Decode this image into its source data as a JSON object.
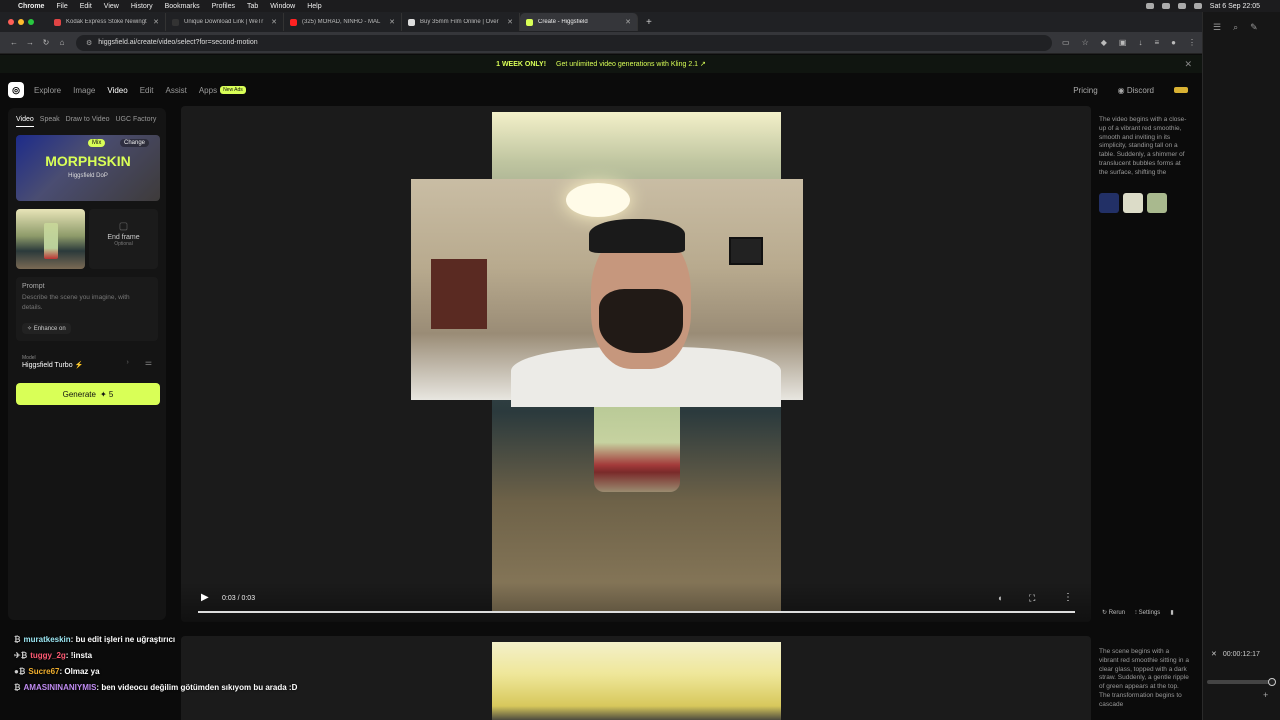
{
  "menubar": {
    "app": "Chrome",
    "items": [
      "File",
      "Edit",
      "View",
      "History",
      "Bookmarks",
      "Profiles",
      "Tab",
      "Window",
      "Help"
    ],
    "clock": "Sat 6 Sep  22:05"
  },
  "tabs": [
    {
      "title": "Kodak Express Stoke Newingt",
      "favcolor": "#e04444"
    },
    {
      "title": "Unique Download Link | WeTr",
      "favcolor": "#333333"
    },
    {
      "title": "(325) MORAD, NINHO - MAL",
      "favcolor": "#ff2222"
    },
    {
      "title": "Buy 35mm Film Online | Over",
      "favcolor": "#dddddd"
    },
    {
      "title": "Create - Higgsfield",
      "favcolor": "#d9ff57"
    }
  ],
  "address": {
    "url": "higgsfield.ai/create/video/select?for=second-motion"
  },
  "banner": {
    "tag": "1 WEEK ONLY!",
    "text": "Get unlimited video generations with Kling 2.1 ↗"
  },
  "nav": {
    "links": [
      "Explore",
      "Image",
      "Video",
      "Edit",
      "Assist",
      "Apps"
    ],
    "apps_badge": "New Ads",
    "pricing": "Pricing",
    "discord": "Discord"
  },
  "left": {
    "subtabs": [
      "Video",
      "Speak",
      "Draw to Video",
      "UGC Factory"
    ],
    "effect": {
      "name": "MORPHSKIN",
      "sub": "Higgsfield DoP",
      "mix": "Mix",
      "change": "Change"
    },
    "end_frame": {
      "title": "End frame",
      "sub": "Optional"
    },
    "prompt": {
      "label": "Prompt",
      "placeholder": "Describe the scene you imagine, with details.",
      "enhance": "Enhance on"
    },
    "model": {
      "label": "Model",
      "value": "Higgsfield Turbo ⚡"
    },
    "generate": {
      "label": "Generate",
      "credits": "✦ 5"
    }
  },
  "player": {
    "time": "0:03 / 0:03"
  },
  "description1": "The video begins with a close-up of a vibrant red smoothie, smooth and inviting in its simplicity, standing tall on a table. Suddenly, a shimmer of translucent bubbles forms at the surface, shifting the",
  "actions": {
    "rerun": "Rerun",
    "settings": "Settings"
  },
  "description2": "The scene begins with a vibrant red smoothie sitting in a clear glass, topped with a dark straw. Suddenly, a gentle ripple of green appears at the top. The transformation begins to cascade",
  "chat": [
    {
      "user": "muratkeskin",
      "msg": "bu edit işleri ne uğraştırıcı"
    },
    {
      "user": "tuggy_2g",
      "msg": "!insta"
    },
    {
      "user": "Sucre67",
      "msg": "Olmaz ya"
    },
    {
      "user": "AMASININANIYMIS",
      "msg": "ben videocu değilim götümden sıkıyom bu arada :D"
    }
  ],
  "sidepanel": {
    "timer": "00:00:12:17"
  }
}
